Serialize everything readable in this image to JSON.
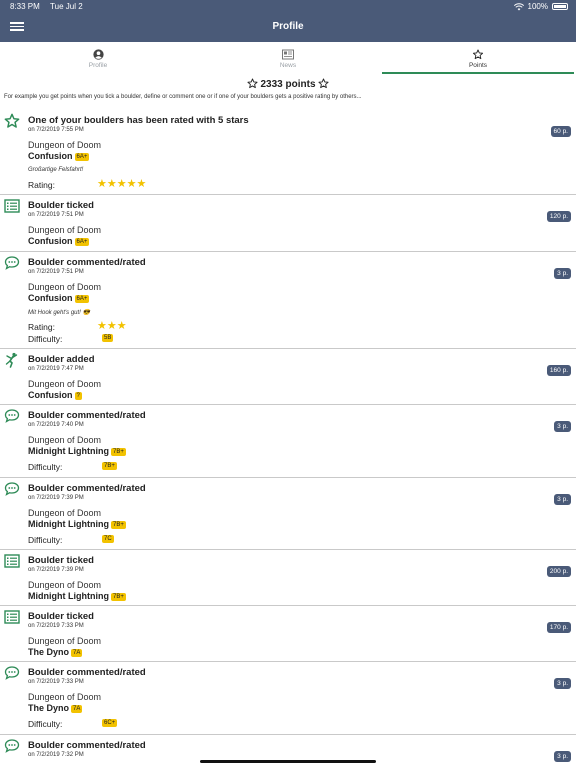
{
  "status": {
    "time": "8:33 PM",
    "date": "Tue Jul 2",
    "battery": "100%"
  },
  "nav": {
    "title": "Profile"
  },
  "tabs": [
    {
      "label": "Profile",
      "icon": "person-circle-icon"
    },
    {
      "label": "News",
      "icon": "newspaper-icon"
    },
    {
      "label": "Points",
      "icon": "star-outline-icon"
    }
  ],
  "points": {
    "total": "2333 points",
    "description": "For example you get points when you tick a boulder, define or comment one or if one of your boulders gets a positive rating by others..."
  },
  "labels": {
    "rating": "Rating:",
    "difficulty": "Difficulty:"
  },
  "colors": {
    "header": "#4a5a78",
    "accent": "#2e8b57",
    "grade": "#f2c200"
  },
  "entries": [
    {
      "type": "rated",
      "icon": "star-outline-icon",
      "title": "One of your boulders has been rated with 5 stars",
      "date": "on 7/2/2019 7:55 PM",
      "area": "Dungeon of Doom",
      "boulder": "Confusion",
      "grade": "6A+",
      "points": "60 p.",
      "comment": "Großartige Felsfahrt!",
      "rating": "★★★★★"
    },
    {
      "type": "ticked",
      "icon": "list-icon",
      "title": "Boulder ticked",
      "date": "on 7/2/2019 7:51 PM",
      "area": "Dungeon of Doom",
      "boulder": "Confusion",
      "grade": "6A+",
      "points": "120 p."
    },
    {
      "type": "commented",
      "icon": "comment-icon",
      "title": "Boulder commented/rated",
      "date": "on 7/2/2019 7:51 PM",
      "area": "Dungeon of Doom",
      "boulder": "Confusion",
      "grade": "6A+",
      "points": "3 p.",
      "comment": "Mit Hook geht's gut! 😎",
      "rating": "★★★",
      "difficulty": "5B"
    },
    {
      "type": "added",
      "icon": "climber-icon",
      "title": "Boulder added",
      "date": "on 7/2/2019 7:47 PM",
      "area": "Dungeon of Doom",
      "boulder": "Confusion",
      "grade": "?",
      "points": "160 p."
    },
    {
      "type": "commented",
      "icon": "comment-icon",
      "title": "Boulder commented/rated",
      "date": "on 7/2/2019 7:40 PM",
      "area": "Dungeon of Doom",
      "boulder": "Midnight Lightning",
      "grade": "7B+",
      "points": "3 p.",
      "difficulty": "7B+"
    },
    {
      "type": "commented",
      "icon": "comment-icon",
      "title": "Boulder commented/rated",
      "date": "on 7/2/2019 7:39 PM",
      "area": "Dungeon of Doom",
      "boulder": "Midnight Lightning",
      "grade": "7B+",
      "points": "3 p.",
      "difficulty": "7C"
    },
    {
      "type": "ticked",
      "icon": "list-icon",
      "title": "Boulder ticked",
      "date": "on 7/2/2019 7:39 PM",
      "area": "Dungeon of Doom",
      "boulder": "Midnight Lightning",
      "grade": "7B+",
      "points": "200 p."
    },
    {
      "type": "ticked",
      "icon": "list-icon",
      "title": "Boulder ticked",
      "date": "on 7/2/2019 7:33 PM",
      "area": "Dungeon of Doom",
      "boulder": "The Dyno",
      "grade": "7A",
      "points": "170 p."
    },
    {
      "type": "commented",
      "icon": "comment-icon",
      "title": "Boulder commented/rated",
      "date": "on 7/2/2019 7:33 PM",
      "area": "Dungeon of Doom",
      "boulder": "The Dyno",
      "grade": "7A",
      "points": "3 p.",
      "difficulty": "6C+"
    },
    {
      "type": "commented",
      "icon": "comment-icon",
      "title": "Boulder commented/rated",
      "date": "on 7/2/2019 7:32 PM",
      "points": "3 p."
    }
  ]
}
